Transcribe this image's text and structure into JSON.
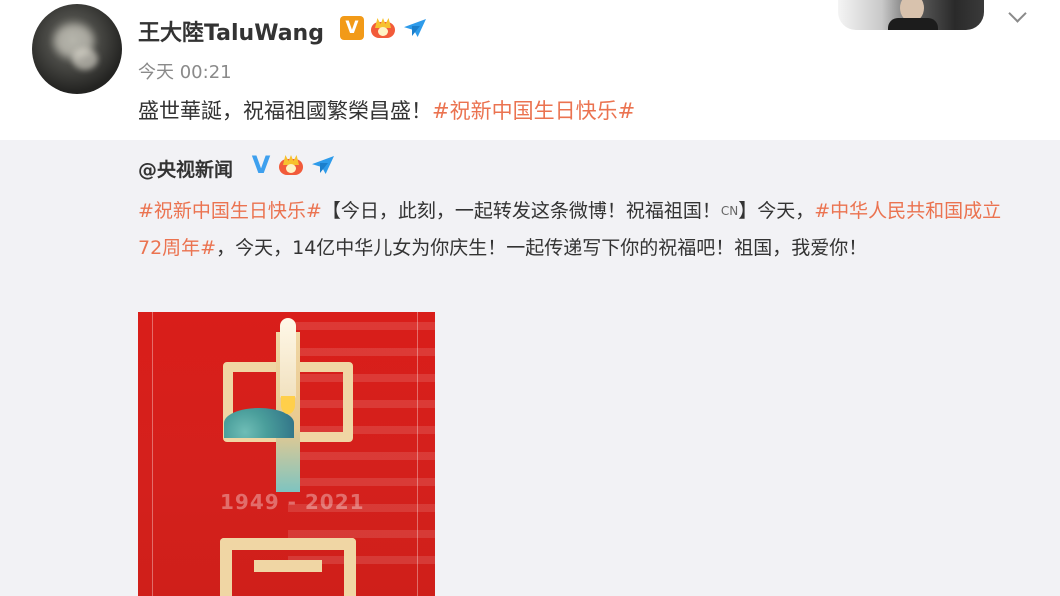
{
  "post": {
    "username": "王大陸TaluWang",
    "timestamp": "今天 00:21",
    "text": "盛世華誕，祝福祖國繁榮昌盛！",
    "hashtag": "#祝新中国生日快乐#",
    "badges": [
      "verified-v-icon",
      "crown-vip-icon",
      "airplane-icon"
    ]
  },
  "repost": {
    "author": "@央视新闻",
    "hashtag1": "#祝新中国生日快乐#",
    "text1": "【今日，此刻，一起转发这条微博！祝福祖国！",
    "cn_label": "CN",
    "text2": "】今天，",
    "hashtag2": "#中华人民共和国成立72周年#",
    "text3": "，今天，14亿中华儿女为你庆生！一起传递写下你的祝福吧！祖国，我爱你！",
    "badges": [
      "verified-v-blue-icon",
      "crown-vip-icon",
      "airplane-icon"
    ]
  },
  "poster": {
    "years": "1949 - 2021"
  },
  "colors": {
    "hashtag": "#eb7350",
    "repost_bg": "#f2f2f5",
    "poster_red": "#d91e1a",
    "v_orange": "#f29a18",
    "v_blue": "#3ea0ee"
  }
}
